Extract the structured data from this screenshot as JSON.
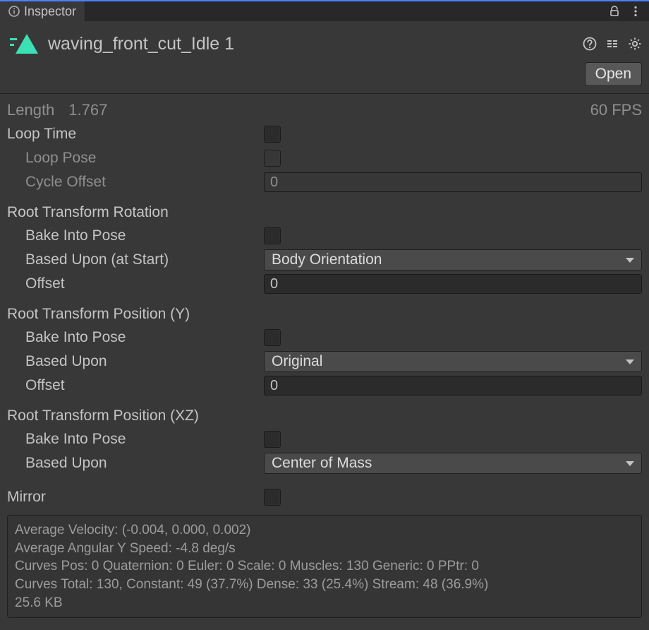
{
  "tab": {
    "title": "Inspector"
  },
  "header": {
    "asset_name": "waving_front_cut_Idle 1",
    "open_button": "Open"
  },
  "length": {
    "label": "Length",
    "value": "1.767",
    "fps": "60 FPS"
  },
  "loop": {
    "time_label": "Loop Time",
    "time_checked": false,
    "pose_label": "Loop Pose",
    "pose_checked": false,
    "cycle_label": "Cycle Offset",
    "cycle_value": "0"
  },
  "rotation": {
    "section": "Root Transform Rotation",
    "bake_label": "Bake Into Pose",
    "bake_checked": false,
    "based_label": "Based Upon (at Start)",
    "based_value": "Body Orientation",
    "offset_label": "Offset",
    "offset_value": "0"
  },
  "posY": {
    "section": "Root Transform Position (Y)",
    "bake_label": "Bake Into Pose",
    "bake_checked": false,
    "based_label": "Based Upon",
    "based_value": "Original",
    "offset_label": "Offset",
    "offset_value": "0"
  },
  "posXZ": {
    "section": "Root Transform Position (XZ)",
    "bake_label": "Bake Into Pose",
    "bake_checked": false,
    "based_label": "Based Upon",
    "based_value": "Center of Mass"
  },
  "mirror": {
    "label": "Mirror",
    "checked": false
  },
  "info": {
    "l1": "Average Velocity: (-0.004, 0.000, 0.002)",
    "l2": "Average Angular Y Speed: -4.8 deg/s",
    "l3": "Curves Pos: 0 Quaternion: 0 Euler: 0 Scale: 0 Muscles: 130 Generic: 0 PPtr: 0",
    "l4": "Curves Total: 130, Constant: 49 (37.7%) Dense: 33 (25.4%) Stream: 48 (36.9%)",
    "l5": "25.6 KB"
  }
}
